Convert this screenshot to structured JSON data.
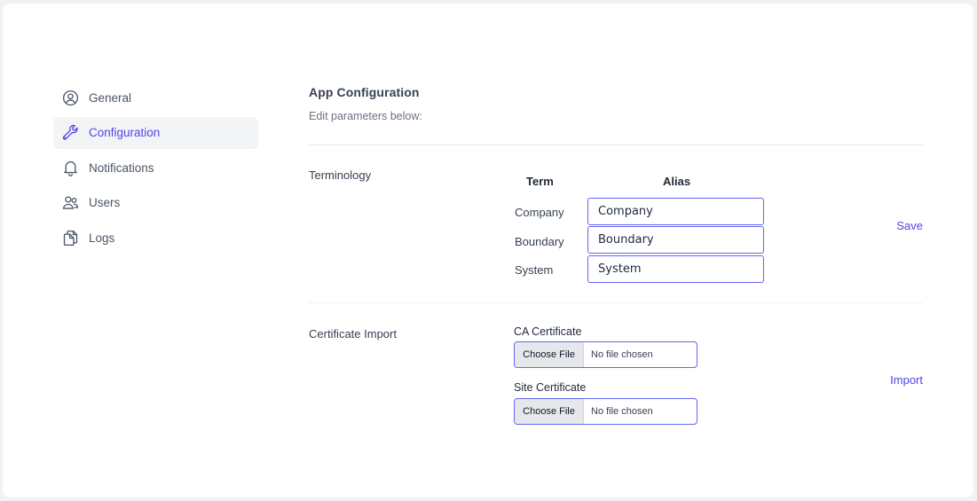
{
  "sidebar": {
    "items": [
      {
        "label": "General",
        "icon": "user-circle-icon"
      },
      {
        "label": "Configuration",
        "icon": "wrench-icon",
        "active": true
      },
      {
        "label": "Notifications",
        "icon": "bell-icon"
      },
      {
        "label": "Users",
        "icon": "users-icon"
      },
      {
        "label": "Logs",
        "icon": "documents-icon"
      }
    ]
  },
  "main": {
    "title": "App Configuration",
    "subtitle": "Edit parameters below:",
    "terminology": {
      "label": "Terminology",
      "term_header": "Term",
      "alias_header": "Alias",
      "rows": [
        {
          "term": "Company",
          "alias": "Company"
        },
        {
          "term": "Boundary",
          "alias": "Boundary"
        },
        {
          "term": "System",
          "alias": "System"
        }
      ],
      "save_label": "Save"
    },
    "certificates": {
      "label": "Certificate Import",
      "ca_label": "CA Certificate",
      "site_label": "Site Certificate",
      "choose_label": "Choose File",
      "no_file_text": "No file chosen",
      "import_label": "Import"
    }
  },
  "colors": {
    "accent": "#4f46e5",
    "input_border": "#6366f1",
    "active_bg": "#f3f4f6"
  }
}
